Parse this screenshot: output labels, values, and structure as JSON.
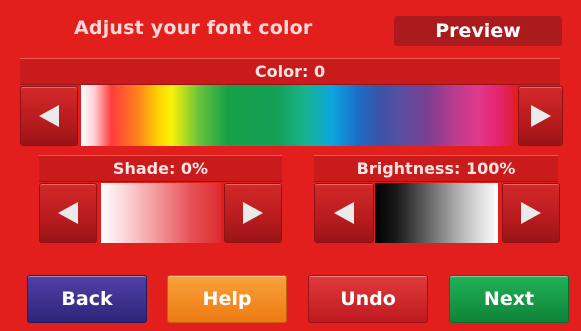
{
  "header": {
    "title": "Adjust your font color",
    "preview_label": "Preview"
  },
  "color": {
    "label": "Color: 0",
    "value": 0
  },
  "shade": {
    "label": "Shade: 0%",
    "value_percent": 0
  },
  "brightness": {
    "label": "Brightness: 100%",
    "value_percent": 100
  },
  "footer": {
    "back_label": "Back",
    "help_label": "Help",
    "undo_label": "Undo",
    "next_label": "Next"
  },
  "colors": {
    "background": "#e21f1d",
    "back": "#3c2d8e",
    "help": "#f4861f",
    "undo": "#d32228",
    "next": "#149945"
  },
  "icons": {
    "left_arrow": "left-arrow-icon",
    "right_arrow": "right-arrow-icon"
  }
}
